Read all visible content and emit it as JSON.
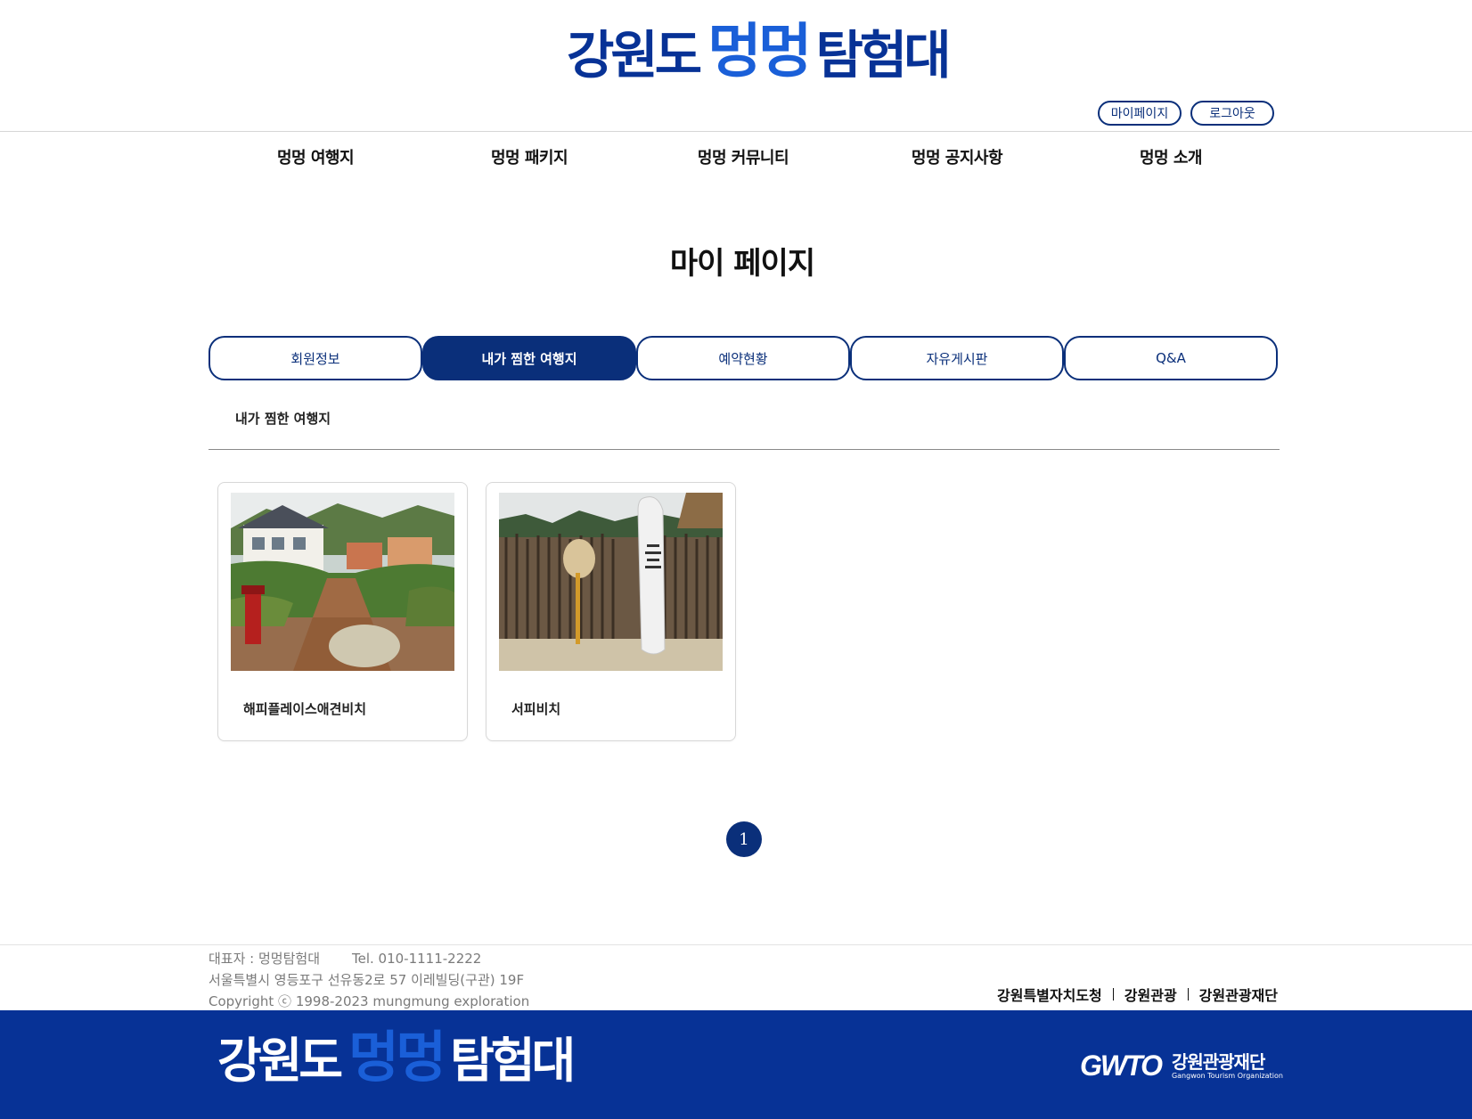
{
  "header": {
    "logo": {
      "part1": "강원도",
      "part2": "멍멍",
      "part3": "탐험대"
    },
    "links": {
      "mypage": "마이페이지",
      "logout": "로그아웃"
    }
  },
  "nav": {
    "items": [
      "멍멍 여행지",
      "멍멍 패키지",
      "멍멍 커뮤니티",
      "멍멍 공지사항",
      "멍멍 소개"
    ]
  },
  "page": {
    "title": "마이 페이지",
    "tabs": [
      "회원정보",
      "내가 찜한 여행지",
      "예약현황",
      "자유게시판",
      "Q&A"
    ],
    "active_tab": "내가 찜한 여행지",
    "section_label": "내가 찜한 여행지"
  },
  "cards": [
    {
      "title": "해피플레이스애견비치",
      "image": "garden-pension-photo"
    },
    {
      "title": "서피비치",
      "image": "surfboard-beach-photo"
    }
  ],
  "pagination": {
    "current": "1"
  },
  "footer": {
    "representative": "대표자 : 멍멍탐험대",
    "tel": "Tel. 010-1111-2222",
    "address": "서울특별시 영등포구 선유동2로 57 이레빌딩(구관) 19F",
    "copyright": "Copyright ⓒ 1998-2023 mungmung exploration",
    "links": [
      "강원특별자치도청",
      "강원관광",
      "강원관광재단"
    ],
    "logo": {
      "part1": "강원도",
      "part2": "멍멍",
      "part3": "탐험대"
    },
    "gwto": {
      "mark": "GWTO",
      "ko": "강원관광재단",
      "en": "Gangwon Tourism Organization"
    }
  },
  "colors": {
    "primary": "#0a2f7a",
    "logo_dark": "#073296",
    "logo_light": "#1a5fd8"
  }
}
